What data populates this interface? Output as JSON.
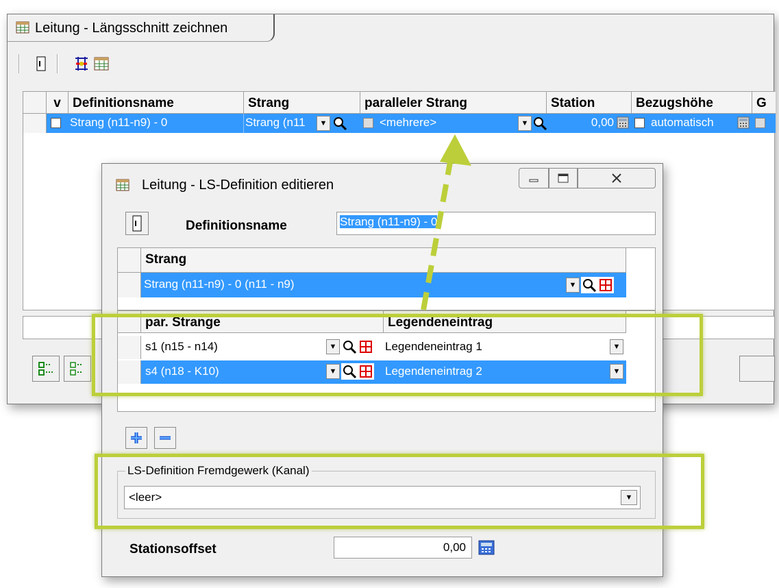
{
  "main_window": {
    "title": "Leitung - Längsschnitt zeichnen",
    "grid": {
      "columns": [
        "v",
        "Definitionsname",
        "Strang",
        "paralleler Strang",
        "Station",
        "Bezugshöhe",
        "G"
      ],
      "row": {
        "definitionsname": "Strang (n11-n9) - 0",
        "strang": "Strang (n11",
        "paralleler_strang": "<mehrere>",
        "station": "0,00",
        "bezugshoehe": "automatisch"
      }
    }
  },
  "dialog": {
    "title": "Leitung - LS-Definition editieren",
    "definitionsname_label": "Definitionsname",
    "definitionsname_value": "Strang (n11-n9) - 0",
    "strang_grid": {
      "header": "Strang",
      "row": "Strang (n11-n9) - 0   (n11 - n9)"
    },
    "par_grid": {
      "headers": [
        "par. Strange",
        "Legendeneintrag"
      ],
      "rows": [
        {
          "strang": "s1   (n15 - n14)",
          "legende": "Legendeneintrag 1"
        },
        {
          "strang": "s4   (n18 - K10)",
          "legende": "Legendeneintrag 2"
        }
      ]
    },
    "fremdgewerk": {
      "label": "LS-Definition Fremdgewerk (Kanal)",
      "value": "<leer>"
    },
    "stationsoffset": {
      "label": "Stationsoffset",
      "value": "0,00"
    }
  },
  "colors": {
    "selection": "#3399ff",
    "highlight_frame": "#bccf3a",
    "window_bg": "#f0f0f0"
  }
}
